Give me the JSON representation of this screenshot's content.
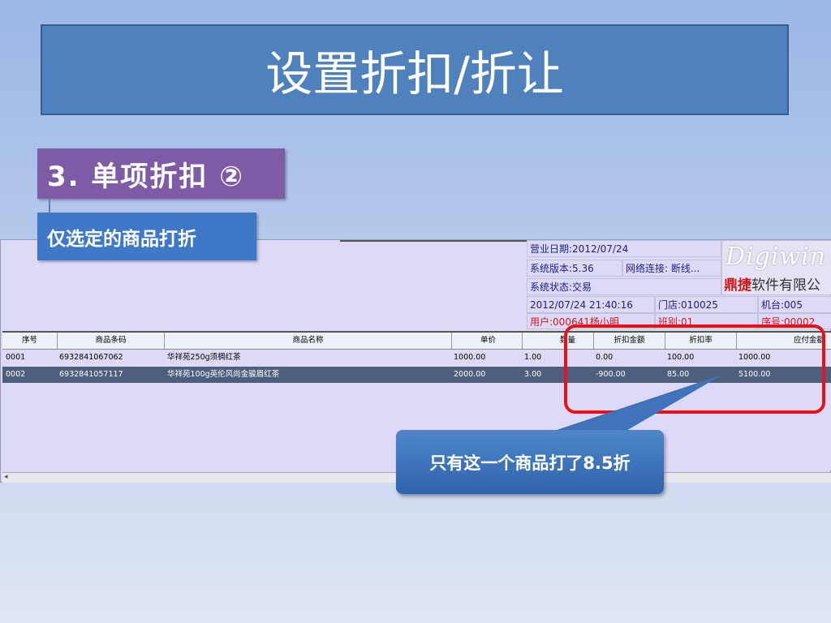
{
  "slide": {
    "title": "设置折扣/折让",
    "step": "3. 单项折扣 ②",
    "subtitle": "仅选定的商品打折",
    "callout": "只有这一个商品打了8.5折"
  },
  "status": {
    "business_date": "营业日期:2012/07/24",
    "version": "系统版本:5.36",
    "network": "网络连接: 断线...",
    "state": "系统状态:交易",
    "datetime": "2012/07/24 21:40:16",
    "store": "门店:010025",
    "machine": "机台:005",
    "user": "用户:000641杨小明",
    "shift": "班别:01",
    "serial": "序号:00002"
  },
  "logo": {
    "script": "Digiwin",
    "company_hl": "鼎捷",
    "company_rest": "软件有限公司"
  },
  "table": {
    "headers": [
      "序号",
      "商品条码",
      "商品名称",
      "单价",
      "数量",
      "折扣金额",
      "折扣率",
      "应付金额"
    ],
    "rows": [
      [
        "0001",
        "6932841067062",
        "华祥苑250g须椆红茶",
        "1000.00",
        "1.00",
        "0.00",
        "100.00",
        "1000.00"
      ],
      [
        "0002",
        "6932841057117",
        "华祥苑100g英伦风尚金骏眉红茶",
        "2000.00",
        "3.00",
        "-900.00",
        "85.00",
        "5100.00"
      ]
    ]
  },
  "colors": {
    "title_bg": "#4f81bd",
    "step_bg": "#7f5ba6",
    "subtitle_bg": "#3e78c6",
    "highlight": "#e8101a",
    "selected_row": "#4e5f7d"
  }
}
